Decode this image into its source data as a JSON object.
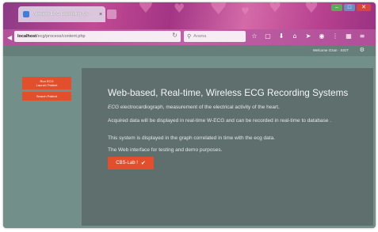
{
  "browser": {
    "tab_title": "Wireless ECG Recording Sy...",
    "tab_close": "×",
    "url_host": "localhost",
    "url_path": "/ecg/process/content.php",
    "search_placeholder": "Arama",
    "window_controls": {
      "minimize": "–",
      "maximize": "□",
      "close": "✕"
    },
    "toolbar_icons": [
      "star-icon",
      "clipboard-icon",
      "download-icon",
      "home-icon",
      "send-icon",
      "chat-icon",
      "more-icon",
      "extension-icon",
      "menu-icon"
    ],
    "theme_colors": {
      "primary": "#b04a92",
      "accent": "#d46aa8"
    }
  },
  "page": {
    "welcome_text": "Welcome Ozan · SIGT",
    "sidebar": {
      "items": [
        {
          "line1": "Run ECG",
          "line2": "Launch Patient"
        },
        {
          "line1": "Search Patient",
          "line2": ""
        }
      ]
    },
    "hero": {
      "headline": "Web-based, Real-time, Wireless ECG Recording Systems",
      "lead_em": "ECG",
      "lead_rest": " electrocardiograph, measurement of the electrical activity of the heart.",
      "p2": "Acquired data will be displayed in real-time W-ECG and can be recorded in real-time to database .",
      "p3": "This system is displayed in the graph correlated in time with the ecg data.",
      "p4": "The Web interface for testing and demo purposes.",
      "cta_label": "CBS-Lab !"
    },
    "colors": {
      "accent": "#e14f2c",
      "panel": "#5f6f6e",
      "background": "#728f89"
    }
  }
}
